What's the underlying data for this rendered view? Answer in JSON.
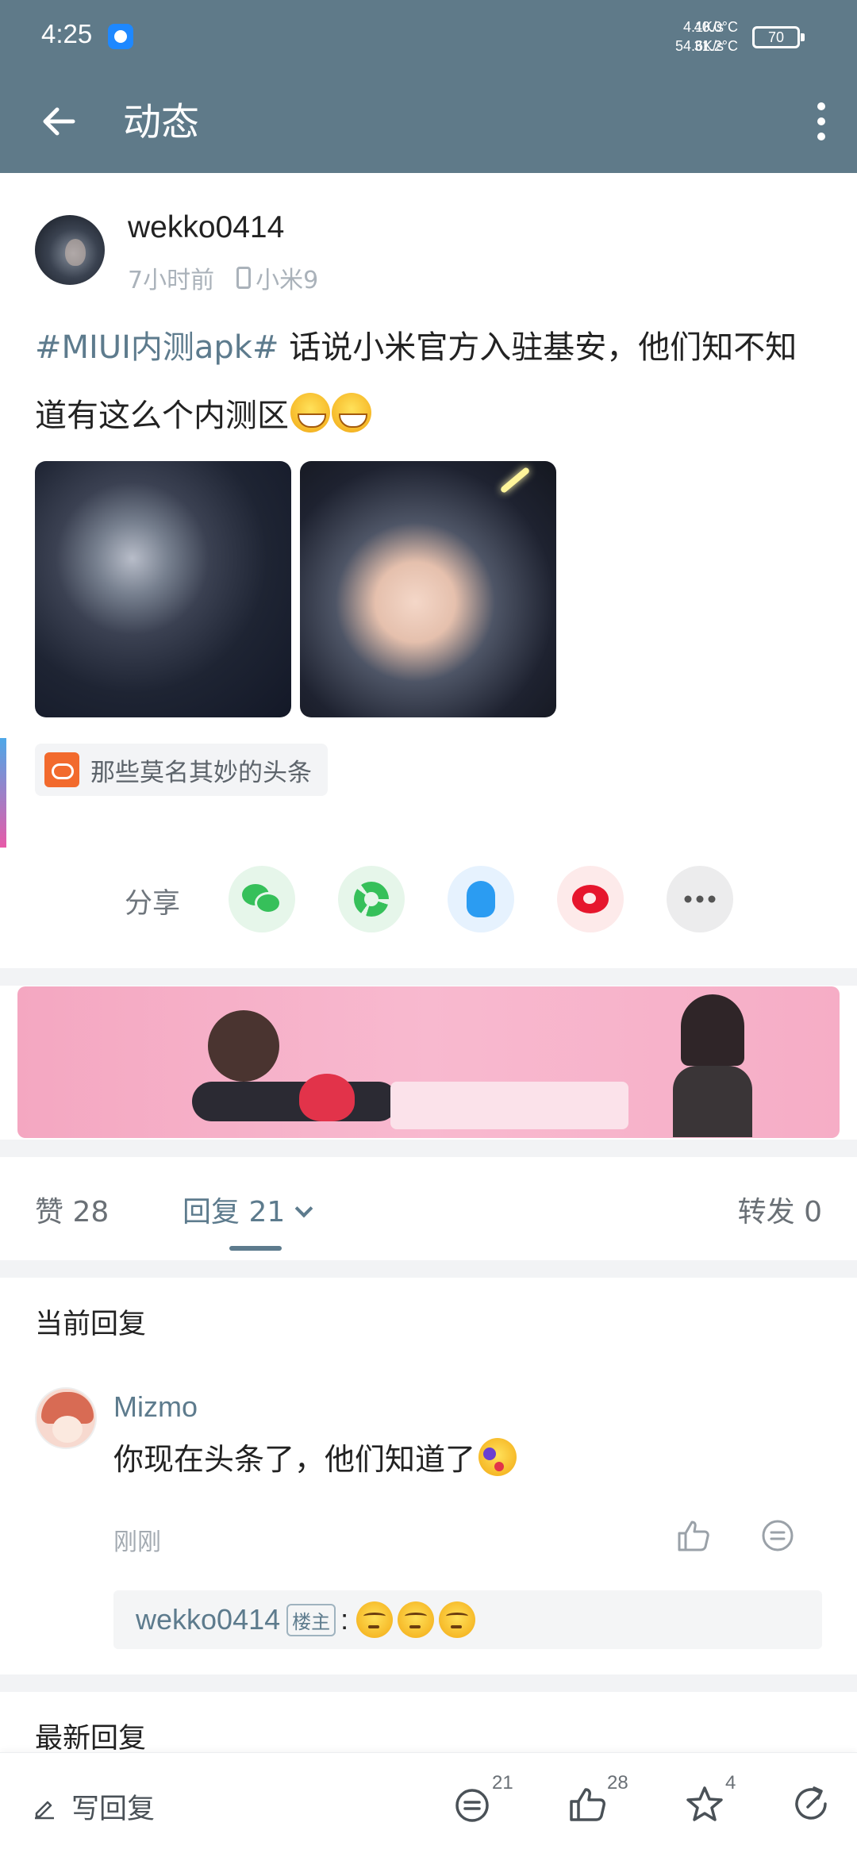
{
  "status_bar": {
    "time": "4:25",
    "net_up": "4.1K/s",
    "net_down": "54.6K/s",
    "temp1": "40.0°C",
    "temp2": "31.2°C",
    "battery": "70"
  },
  "header": {
    "title": "动态"
  },
  "post": {
    "username": "wekko0414",
    "time_ago": "7小时前",
    "device": "小米9",
    "hashtag": "#MIUI内测apk#",
    "text": " 话说小米官方入驻基安，他们知不知道有这么个内测区",
    "topic_chip": "那些莫名其妙的头条"
  },
  "share": {
    "label": "分享",
    "icons": [
      "wechat-icon",
      "moments-icon",
      "qq-icon",
      "weibo-icon",
      "more-icon"
    ]
  },
  "tabs": {
    "like": "赞 28",
    "reply": "回复 21",
    "forward": "转发 0"
  },
  "current_reply": {
    "section_title": "当前回复",
    "username": "Mizmo",
    "text": "你现在头条了，他们知道了",
    "time": "刚刚",
    "quote_user": "wekko0414",
    "quote_badge": "楼主",
    "quote_colon": ":"
  },
  "latest_reply": {
    "section_title": "最新回复"
  },
  "bottom_bar": {
    "write_reply": "写回复",
    "comment_count": "21",
    "like_count": "28",
    "star_count": "4"
  },
  "colors": {
    "header_bg": "#5f7a89",
    "accent": "#5d7b8d",
    "wechat_green": "#36c05a",
    "qq_blue": "#2b9cf2",
    "weibo_red": "#e6162d"
  }
}
